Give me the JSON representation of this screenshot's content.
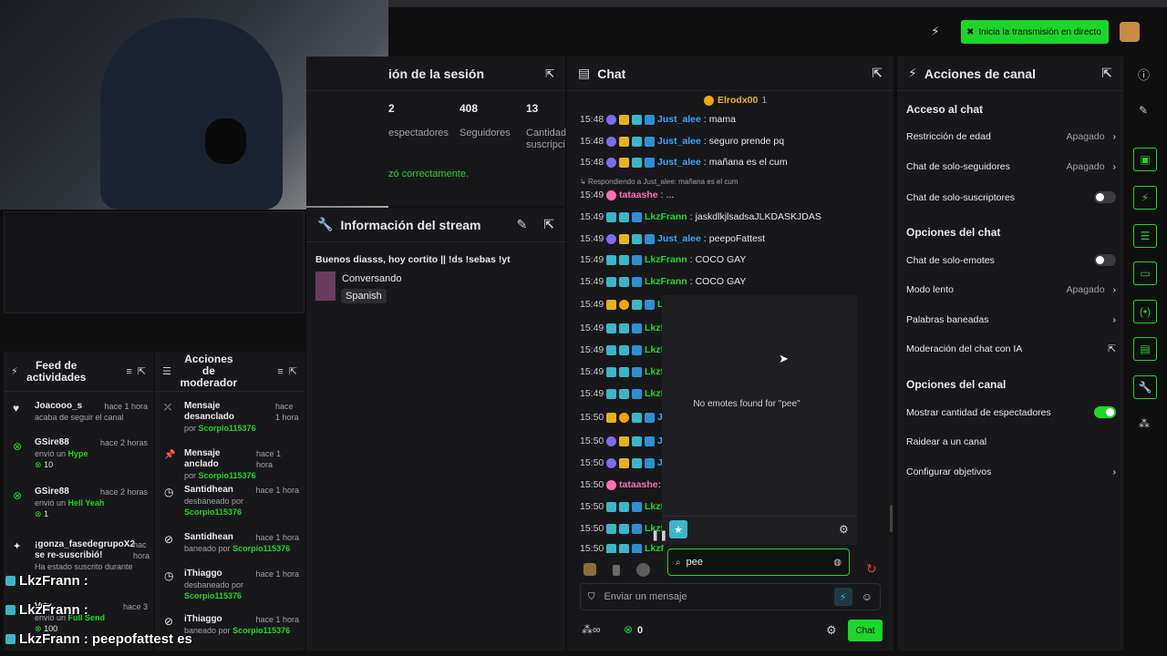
{
  "topbar": {
    "live_button": "Inicia la transmisión en directo"
  },
  "session": {
    "title": "ión de la sesión",
    "stats": [
      {
        "value": "2",
        "label": "espectadores"
      },
      {
        "value": "408",
        "label": "Seguidores"
      },
      {
        "value": "13",
        "label": "Cantidad suscripci"
      }
    ],
    "notice": "zó correctamente."
  },
  "stream_info": {
    "title": "Información del stream",
    "stream_title": "Buenos diasss, hoy cortito || !ds !sebas !yt",
    "category": "Conversando",
    "language_tag": "Spanish"
  },
  "chat": {
    "title": "Chat",
    "pinned_user": "Elrodx00",
    "pinned_count": "1",
    "reply_note": "Respondiendo a Just_alee: mañana es el cum",
    "lines": [
      {
        "time": "15:48",
        "user": "Just_alee",
        "msg": "mama",
        "color": "#3aa5ff"
      },
      {
        "time": "15:48",
        "user": "Just_alee",
        "msg": "seguro prende pq",
        "color": "#3aa5ff"
      },
      {
        "time": "15:48",
        "user": "Just_alee",
        "msg": "mañana es el cum",
        "color": "#3aa5ff"
      },
      {
        "time": "15:49",
        "user": "tataashe",
        "msg": "...",
        "color": "#ff6fb1"
      },
      {
        "time": "15:49",
        "user": "LkzFrann",
        "msg": "jaskdlkjlsadsaJLKDASKJDAS",
        "color": "#1ed62a"
      },
      {
        "time": "15:49",
        "user": "Just_alee",
        "msg": "peepoFattest",
        "color": "#3aa5ff"
      },
      {
        "time": "15:49",
        "user": "LkzFrann",
        "msg": "COCO GAY",
        "color": "#1ed62a"
      },
      {
        "time": "15:49",
        "user": "LkzFrann",
        "msg": "COCO GAY",
        "color": "#1ed62a"
      }
    ],
    "partial_times": [
      "15:49",
      "15:49",
      "15:49",
      "15:49",
      "15:49",
      "15:50",
      "15:50",
      "15:50",
      "15:50",
      "15:50",
      "15:50",
      "15:50"
    ],
    "partial_users": [
      "L",
      "Lkzf",
      "Lkzf",
      "Lkzf",
      "Lkzf",
      "J",
      "J",
      "J",
      "tataashe: c",
      "Lkzf",
      "Lkzf",
      "Lkzf"
    ],
    "emote_empty": "No emotes found for \"pee\"",
    "emote_search_value": "pee",
    "message_placeholder": "Enviar un mensaje",
    "points": "0",
    "send_button": "Chat"
  },
  "channel_actions": {
    "title": "Acciones de canal",
    "sections": [
      {
        "heading": "Acceso al chat"
      },
      {
        "heading": "Opciones del chat"
      },
      {
        "heading": "Opciones del canal"
      }
    ],
    "rows": [
      {
        "label": "Restricción de edad",
        "value": "Apagado",
        "type": "chevron"
      },
      {
        "label": "Chat de solo-seguidores",
        "value": "Apagado",
        "type": "chevron"
      },
      {
        "label": "Chat de solo-suscriptores",
        "value": "",
        "type": "toggle-off"
      },
      {
        "label": "Chat de solo-emotes",
        "value": "",
        "type": "toggle-off"
      },
      {
        "label": "Modo lento",
        "value": "Apagado",
        "type": "chevron"
      },
      {
        "label": "Palabras baneadas",
        "value": "",
        "type": "chevron"
      },
      {
        "label": "Moderación del chat con IA",
        "value": "",
        "type": "external"
      },
      {
        "label": "Mostrar cantidad de espectadores",
        "value": "",
        "type": "toggle-on"
      },
      {
        "label": "Raidear a un canal",
        "value": "",
        "type": "none"
      },
      {
        "label": "Configurar objetivos",
        "value": "",
        "type": "chevron"
      }
    ]
  },
  "feed": {
    "title": "Feed de actividades",
    "items": [
      {
        "user": "Joacooo_s",
        "time": "hace 1 hora",
        "line2": "acaba de seguir el canal",
        "line3": ""
      },
      {
        "user": "GSire88",
        "time": "hace 2 horas",
        "line2": "envió un",
        "gift": "Hype",
        "line3": "10"
      },
      {
        "user": "GSire88",
        "time": "hace 2 horas",
        "line2": "envió un",
        "gift": "Hell Yeah",
        "line3": "1"
      },
      {
        "user": "¡gonza_fasedegrupoX2 se re-suscribió!",
        "time": "hac hora",
        "line2": "Ha estado suscrito durante",
        "line3": ""
      },
      {
        "user": "Vrtx",
        "time": "hace 3",
        "line2": "envió un",
        "gift": "Full Send",
        "line3": "100"
      }
    ]
  },
  "mod": {
    "title": "Acciones de moderador",
    "items": [
      {
        "action": "Mensaje desanclado",
        "time": "hace 1 hora",
        "by_prefix": "por",
        "by": "Scorpio115376"
      },
      {
        "action": "Mensaje anclado",
        "time": "hace 1 hora",
        "by_prefix": "por",
        "by": "Scorpio115376"
      },
      {
        "action": "Santidhean",
        "time": "hace 1 hora",
        "by_prefix": "desbaneado por",
        "by": "Scorpio115376"
      },
      {
        "action": "Santidhean",
        "time": "hace 1 hora",
        "by_prefix": "baneado por",
        "by": "Scorpio115376"
      },
      {
        "action": "iThiaggo",
        "time": "hace 1 hora",
        "by_prefix": "desbaneado por",
        "by": "Scorpio115376"
      },
      {
        "action": "iThiaggo",
        "time": "hace 1 hora",
        "by_prefix": "baneado por",
        "by": "Scorpio115376"
      }
    ]
  },
  "overlay": {
    "lines": [
      {
        "name": "LkzFrann",
        "text": ":"
      },
      {
        "name": "LkzFrann",
        "text": ":"
      },
      {
        "name": "LkzFrann",
        "text": ": peepofattest es"
      }
    ]
  },
  "colors": {
    "accent": "#1ed62a",
    "panel": "#18181b",
    "bg": "#0f0f10"
  }
}
